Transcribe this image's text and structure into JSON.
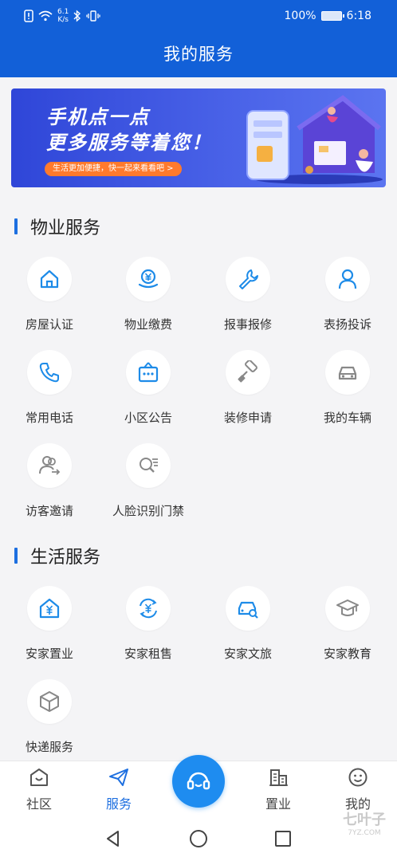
{
  "status": {
    "speed_top": "6.1",
    "speed_bottom": "K/s",
    "battery_pct": "100%",
    "time": "6:18"
  },
  "header": {
    "title": "我的服务"
  },
  "banner": {
    "line1": "手机点一点",
    "line2": "更多服务等着您！",
    "pill": "生活更加便捷，快一起来看看吧 >"
  },
  "sections": {
    "property": {
      "title": "物业服务",
      "items": [
        {
          "label": "房屋认证",
          "icon": "house-icon"
        },
        {
          "label": "物业缴费",
          "icon": "yuan-payment-icon"
        },
        {
          "label": "报事报修",
          "icon": "wrench-icon"
        },
        {
          "label": "表扬投诉",
          "icon": "person-icon"
        },
        {
          "label": "常用电话",
          "icon": "phone-icon"
        },
        {
          "label": "小区公告",
          "icon": "notice-board-icon"
        },
        {
          "label": "装修申请",
          "icon": "paint-roller-icon"
        },
        {
          "label": "我的车辆",
          "icon": "car-icon"
        },
        {
          "label": "访客邀请",
          "icon": "visitor-icon"
        },
        {
          "label": "人脸识别门禁",
          "icon": "face-scan-icon"
        }
      ]
    },
    "life": {
      "title": "生活服务",
      "items": [
        {
          "label": "安家置业",
          "icon": "house-yuan-icon"
        },
        {
          "label": "安家租售",
          "icon": "yuan-exchange-icon"
        },
        {
          "label": "安家文旅",
          "icon": "car-search-icon"
        },
        {
          "label": "安家教育",
          "icon": "graduation-cap-icon"
        },
        {
          "label": "快递服务",
          "icon": "package-icon"
        }
      ]
    }
  },
  "tabbar": {
    "tabs": [
      {
        "label": "社区",
        "icon": "community-icon"
      },
      {
        "label": "服务",
        "icon": "paper-plane-icon"
      },
      {
        "label": "置业",
        "icon": "building-icon"
      },
      {
        "label": "我的",
        "icon": "smiley-icon"
      }
    ],
    "center_icon": "headset-icon",
    "active": "服务"
  },
  "watermark": {
    "text": "七叶子",
    "sub": "7YZ.COM"
  },
  "colors": {
    "primary": "#1260d8",
    "accent": "#1d6fe0",
    "banner": "#3a52e0"
  }
}
